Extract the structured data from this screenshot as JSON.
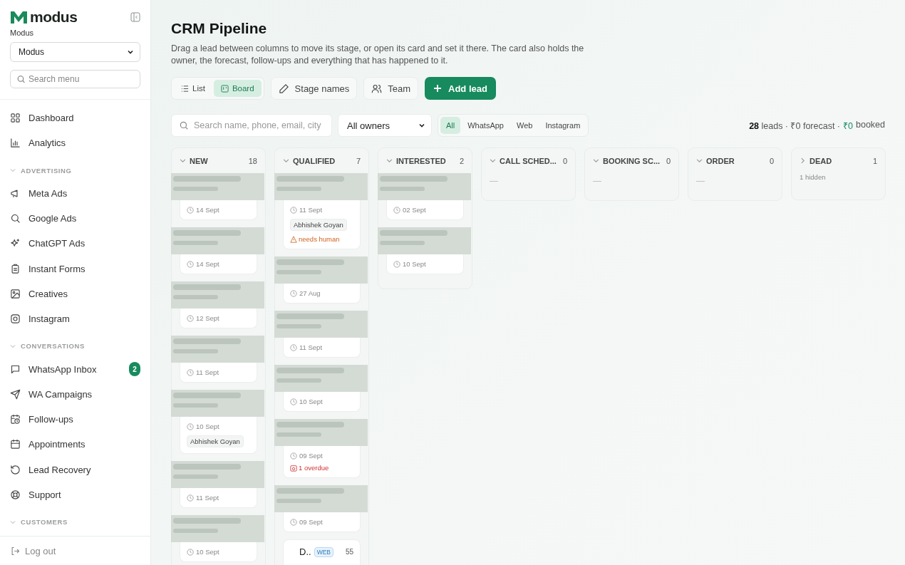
{
  "sidebar": {
    "brand": "modus",
    "workspace_label": "Modus",
    "workspace_select": "Modus",
    "search": {
      "placeholder": "Search menu"
    },
    "items": [
      {
        "kind": "item",
        "label": "Dashboard",
        "selected": false
      },
      {
        "kind": "item",
        "label": "Analytics",
        "selected": false
      },
      {
        "kind": "section",
        "label": "ADVERTISING",
        "expanded": true
      },
      {
        "kind": "item",
        "label": "Meta Ads",
        "selected": false
      },
      {
        "kind": "item",
        "label": "Google Ads",
        "selected": false
      },
      {
        "kind": "item",
        "label": "ChatGPT Ads",
        "selected": false
      },
      {
        "kind": "item",
        "label": "Instant Forms",
        "selected": false
      },
      {
        "kind": "item",
        "label": "Creatives",
        "selected": false
      },
      {
        "kind": "item",
        "label": "Instagram",
        "selected": false
      },
      {
        "kind": "section",
        "label": "CONVERSATIONS",
        "expanded": true
      },
      {
        "kind": "item",
        "label": "WhatsApp Inbox",
        "selected": false,
        "badge": "2"
      },
      {
        "kind": "item",
        "label": "WA Campaigns",
        "selected": false
      },
      {
        "kind": "item",
        "label": "Follow-ups",
        "selected": false
      },
      {
        "kind": "item",
        "label": "Appointments",
        "selected": false
      },
      {
        "kind": "item",
        "label": "Lead Recovery",
        "selected": false
      },
      {
        "kind": "item",
        "label": "Support",
        "selected": false
      },
      {
        "kind": "section",
        "label": "CUSTOMERS",
        "expanded": true
      }
    ],
    "logout": "Log out"
  },
  "page": {
    "title": "CRM Pipeline",
    "description": "Drag a lead between columns to move its stage, or open its card and set it there. The card also holds the owner, the forecast, follow-ups and everything that has happened to it."
  },
  "toolbar": {
    "views": [
      {
        "label": "List",
        "selected": false
      },
      {
        "label": "Board",
        "selected": true
      }
    ],
    "stage_names": "Stage names",
    "team": "Team",
    "add_lead": "Add lead"
  },
  "filters": {
    "search": {
      "placeholder": "Search name, phone, email, city"
    },
    "owner": "All owners",
    "sources": [
      {
        "label": "All",
        "selected": true
      },
      {
        "label": "WhatsApp",
        "selected": false
      },
      {
        "label": "Web",
        "selected": false
      },
      {
        "label": "Instagram",
        "selected": false
      }
    ],
    "summary": "**28** leads · ₹0 forecast ·",
    "booked_amount": "₹0",
    "booked_label": "booked"
  },
  "columns": [
    {
      "name": "NEW",
      "count": "18",
      "expanded": true,
      "cards": [
        {
          "redacted": true,
          "date": "14 Sept"
        },
        {
          "redacted": true,
          "date": "14 Sept"
        },
        {
          "redacted": true,
          "date": "12 Sept"
        },
        {
          "redacted": true,
          "date": "11 Sept"
        },
        {
          "redacted": true,
          "date": "10 Sept",
          "owner": "Abhishek Goyan"
        },
        {
          "redacted": true,
          "date": "11 Sept"
        },
        {
          "redacted": true,
          "date": "10 Sept"
        }
      ]
    },
    {
      "name": "QUALIFIED",
      "count": "7",
      "expanded": true,
      "cards": [
        {
          "redacted": true,
          "date": "11 Sept",
          "owner": "Abhishek Goyan",
          "flag": {
            "kind": "warning",
            "text": "needs human"
          }
        },
        {
          "redacted": true,
          "date": "27 Aug"
        },
        {
          "redacted": true,
          "date": "11 Sept"
        },
        {
          "redacted": true,
          "date": "10 Sept"
        },
        {
          "redacted": true,
          "date": "09 Sept",
          "flag": {
            "kind": "overdue",
            "text": "1 overdue"
          }
        },
        {
          "redacted": true,
          "date": "09 Sept"
        },
        {
          "redacted": false,
          "title": "D..",
          "tag": "WEB",
          "score": "55"
        }
      ]
    },
    {
      "name": "INTERESTED",
      "count": "2",
      "expanded": true,
      "cards": [
        {
          "redacted": true,
          "date": "02 Sept"
        },
        {
          "redacted": true,
          "date": "10 Sept"
        }
      ]
    },
    {
      "name": "CALL SCHED...",
      "count": "0",
      "expanded": true,
      "empty": "—"
    },
    {
      "name": "BOOKING SC...",
      "count": "0",
      "expanded": true,
      "empty": "—"
    },
    {
      "name": "ORDER",
      "count": "0",
      "expanded": true,
      "empty": "—"
    },
    {
      "name": "DEAD",
      "count": "1",
      "expanded": false,
      "hidden": "1 hidden"
    }
  ]
}
